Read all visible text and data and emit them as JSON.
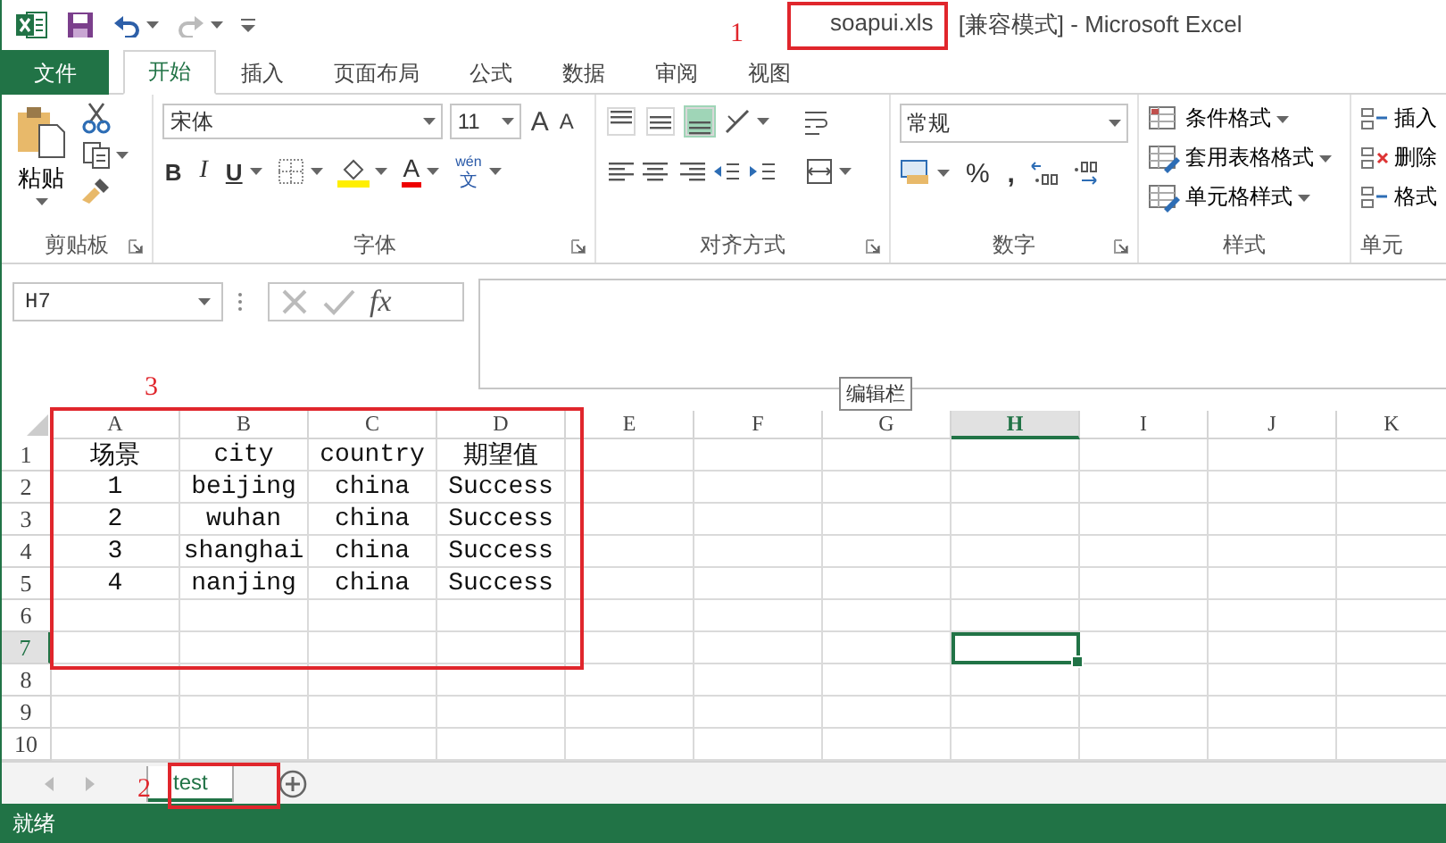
{
  "title_bar": {
    "file_name": "soapui.xls",
    "rest": "[兼容模式] - Microsoft Excel"
  },
  "tabs": [
    {
      "label": "文件",
      "kind": "file",
      "selected": false
    },
    {
      "label": "开始",
      "kind": "tab",
      "selected": true
    },
    {
      "label": "插入",
      "kind": "tab",
      "selected": false
    },
    {
      "label": "页面布局",
      "kind": "tab",
      "selected": false
    },
    {
      "label": "公式",
      "kind": "tab",
      "selected": false
    },
    {
      "label": "数据",
      "kind": "tab",
      "selected": false
    },
    {
      "label": "审阅",
      "kind": "tab",
      "selected": false
    },
    {
      "label": "视图",
      "kind": "tab",
      "selected": false
    }
  ],
  "ribbon": {
    "clipboard": {
      "paste": "粘贴",
      "label": "剪贴板"
    },
    "font": {
      "name": "宋体",
      "size": "11",
      "grow": "A",
      "shrink": "A",
      "bold": "B",
      "italic": "I",
      "underline": "U",
      "font_color_letter": "A",
      "phonetic_top": "wén",
      "phonetic_bottom": "文",
      "label": "字体"
    },
    "alignment": {
      "vertical": [
        {
          "kind": "top",
          "selected": false
        },
        {
          "kind": "middle",
          "selected": false
        },
        {
          "kind": "bottom",
          "selected": true
        }
      ],
      "label": "对齐方式"
    },
    "number": {
      "format": "常规",
      "percent": "%",
      "comma": ",",
      "label": "数字"
    },
    "styles": {
      "items": [
        "条件格式",
        "套用表格格式",
        "单元格样式"
      ],
      "label": "样式"
    },
    "cells": {
      "items": [
        "插入",
        "删除",
        "格式"
      ],
      "label": "单元"
    }
  },
  "formula_bar": {
    "name_box": "H7",
    "fx": "fx",
    "tooltip": "编辑栏"
  },
  "sheet": {
    "columns": [
      {
        "label": "A",
        "selected": false
      },
      {
        "label": "B",
        "selected": false
      },
      {
        "label": "C",
        "selected": false
      },
      {
        "label": "D",
        "selected": false
      },
      {
        "label": "E",
        "selected": false
      },
      {
        "label": "F",
        "selected": false
      },
      {
        "label": "G",
        "selected": false
      },
      {
        "label": "H",
        "selected": true
      },
      {
        "label": "I",
        "selected": false
      },
      {
        "label": "J",
        "selected": false
      },
      {
        "label": "K",
        "selected": false
      }
    ],
    "rows": [
      {
        "number": "1",
        "selected": false,
        "cells": [
          "场景",
          "city",
          "country",
          "期望值"
        ]
      },
      {
        "number": "2",
        "selected": false,
        "cells": [
          "1",
          "beijing",
          "china",
          "Success"
        ]
      },
      {
        "number": "3",
        "selected": false,
        "cells": [
          "2",
          "wuhan",
          "china",
          "Success"
        ]
      },
      {
        "number": "4",
        "selected": false,
        "cells": [
          "3",
          "shanghai",
          "china",
          "Success"
        ]
      },
      {
        "number": "5",
        "selected": false,
        "cells": [
          "4",
          "nanjing",
          "china",
          "Success"
        ]
      },
      {
        "number": "6",
        "selected": false,
        "cells": []
      },
      {
        "number": "7",
        "selected": true,
        "cells": []
      },
      {
        "number": "8",
        "selected": false,
        "cells": []
      },
      {
        "number": "9",
        "selected": false,
        "cells": []
      },
      {
        "number": "10",
        "selected": false,
        "cells": []
      }
    ]
  },
  "sheet_tabs": [
    {
      "label": "test",
      "selected": true
    }
  ],
  "status_bar": {
    "text": "就绪"
  },
  "annotations": [
    {
      "label": "1"
    },
    {
      "label": "2"
    },
    {
      "label": "3"
    }
  ]
}
